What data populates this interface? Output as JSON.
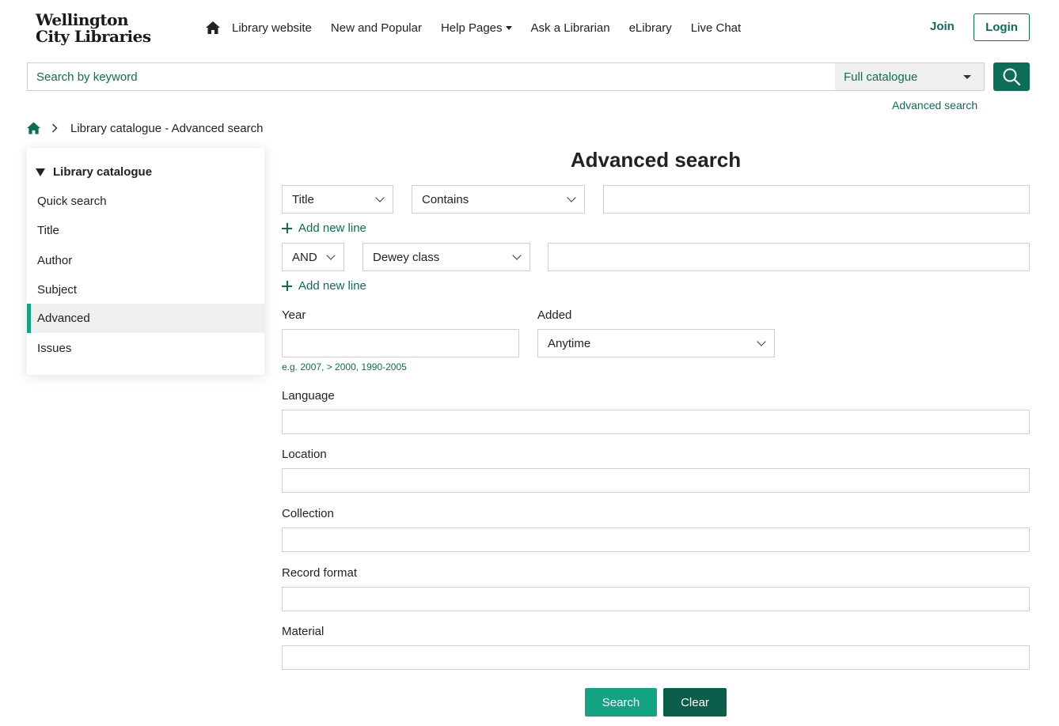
{
  "header": {
    "logo_line1": "Wellington",
    "logo_line2": "City Libraries",
    "nav": {
      "library_website": "Library website",
      "new_popular": "New and Popular",
      "help_pages": "Help Pages",
      "ask_librarian": "Ask a Librarian",
      "elibrary": "eLibrary",
      "live_chat": "Live Chat"
    },
    "join": "Join",
    "login": "Login"
  },
  "search": {
    "placeholder": "Search by keyword",
    "scope": "Full catalogue",
    "advanced_link": "Advanced search"
  },
  "breadcrumb": {
    "current": "Library catalogue - Advanced search"
  },
  "sidebar": {
    "heading": "Library catalogue",
    "items": [
      {
        "label": "Quick search"
      },
      {
        "label": "Title"
      },
      {
        "label": "Author"
      },
      {
        "label": "Subject"
      },
      {
        "label": "Advanced"
      },
      {
        "label": "Issues"
      }
    ]
  },
  "form": {
    "title": "Advanced search",
    "row1": {
      "field": "Title",
      "operator": "Contains",
      "value": ""
    },
    "add_new_line": "Add new line",
    "row2": {
      "bool": "AND",
      "field": "Dewey class",
      "value": ""
    },
    "year_label": "Year",
    "year_hint": "e.g. 2007, > 2000, 1990-2005",
    "added_label": "Added",
    "added_value": "Anytime",
    "language_label": "Language",
    "location_label": "Location",
    "collection_label": "Collection",
    "record_format_label": "Record format",
    "material_label": "Material",
    "search_button": "Search",
    "clear_button": "Clear"
  },
  "colors": {
    "brand": "#0b6e55",
    "accent": "#13a383",
    "dark_button": "#0b5e49"
  }
}
